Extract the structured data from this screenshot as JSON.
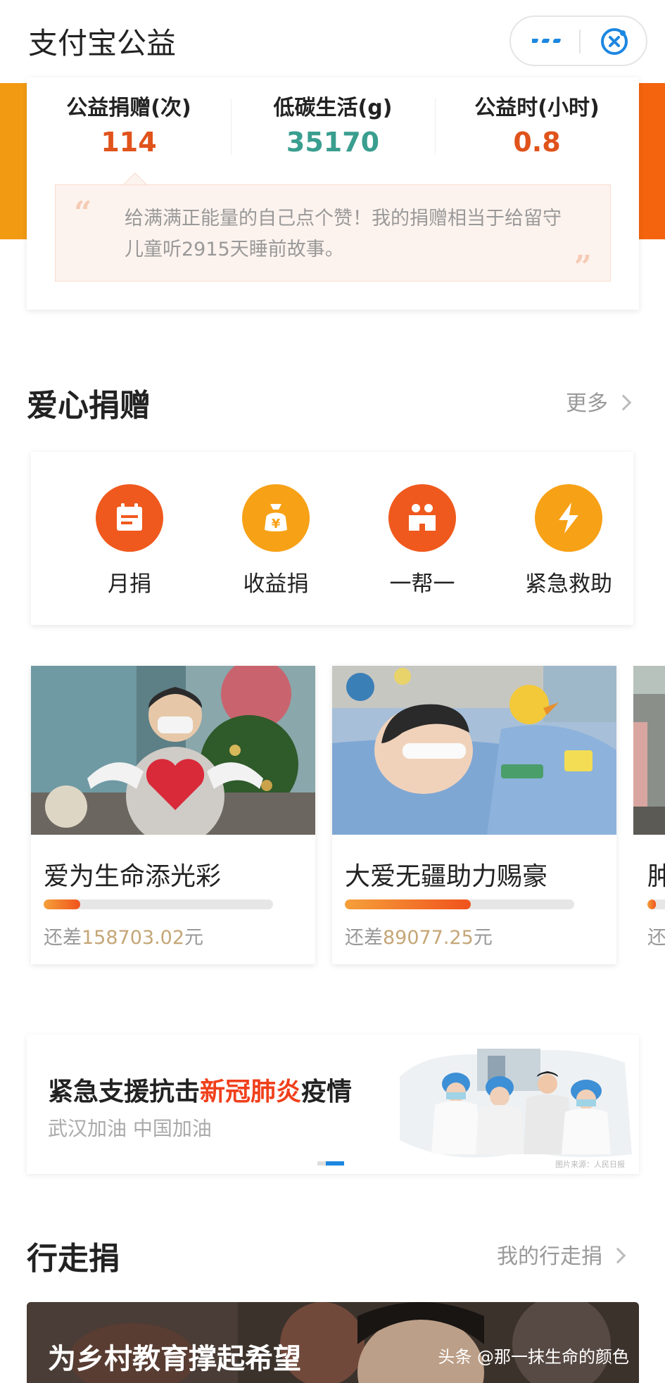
{
  "header": {
    "title": "支付宝公益",
    "more_icon": "ellipsis-icon",
    "close_icon": "close-circle-icon"
  },
  "stats": [
    {
      "label": "公益捐赠(次)",
      "value": "114",
      "color": "#e0531b"
    },
    {
      "label": "低碳生活(g)",
      "value": "35170",
      "color": "#3a9e8f"
    },
    {
      "label": "公益时(小时)",
      "value": "0.8",
      "color": "#e0531b"
    }
  ],
  "quote": "给满满正能量的自己点个赞！我的捐赠相当于给留守儿童听2915天睡前故事。",
  "donation_section": {
    "title": "爱心捐赠",
    "more": "更多",
    "items": [
      {
        "label": "月捐",
        "icon": "calendar-icon",
        "color": "#f0591d"
      },
      {
        "label": "收益捐",
        "icon": "money-bag-icon",
        "color": "#f7a116"
      },
      {
        "label": "一帮一",
        "icon": "two-people-icon",
        "color": "#f0591d"
      },
      {
        "label": "紧急救助",
        "icon": "lightning-icon",
        "color": "#f7a116"
      }
    ]
  },
  "projects": [
    {
      "title": "爱为生命添光彩",
      "remain_prefix": "还差",
      "amount": "158703.02",
      "unit": "元",
      "progress": 0.16
    },
    {
      "title": "大爱无疆助力赐豪",
      "remain_prefix": "还差",
      "amount": "89077.25",
      "unit": "元",
      "progress": 0.55
    },
    {
      "title": "肿",
      "remain_prefix": "还",
      "amount": "",
      "unit": "",
      "progress": 0.1
    }
  ],
  "banner": {
    "title_pre": "紧急支援抗击",
    "title_highlight": "新冠肺炎",
    "title_post": "疫情",
    "subtitle": "武汉加油  中国加油",
    "photo_credit": "图片来源：人民日报"
  },
  "walk_section": {
    "title": "行走捐",
    "more": "我的行走捐",
    "card_title": "为乡村教育撑起希望"
  },
  "watermark": "头条 @那一抹生命的颜色"
}
